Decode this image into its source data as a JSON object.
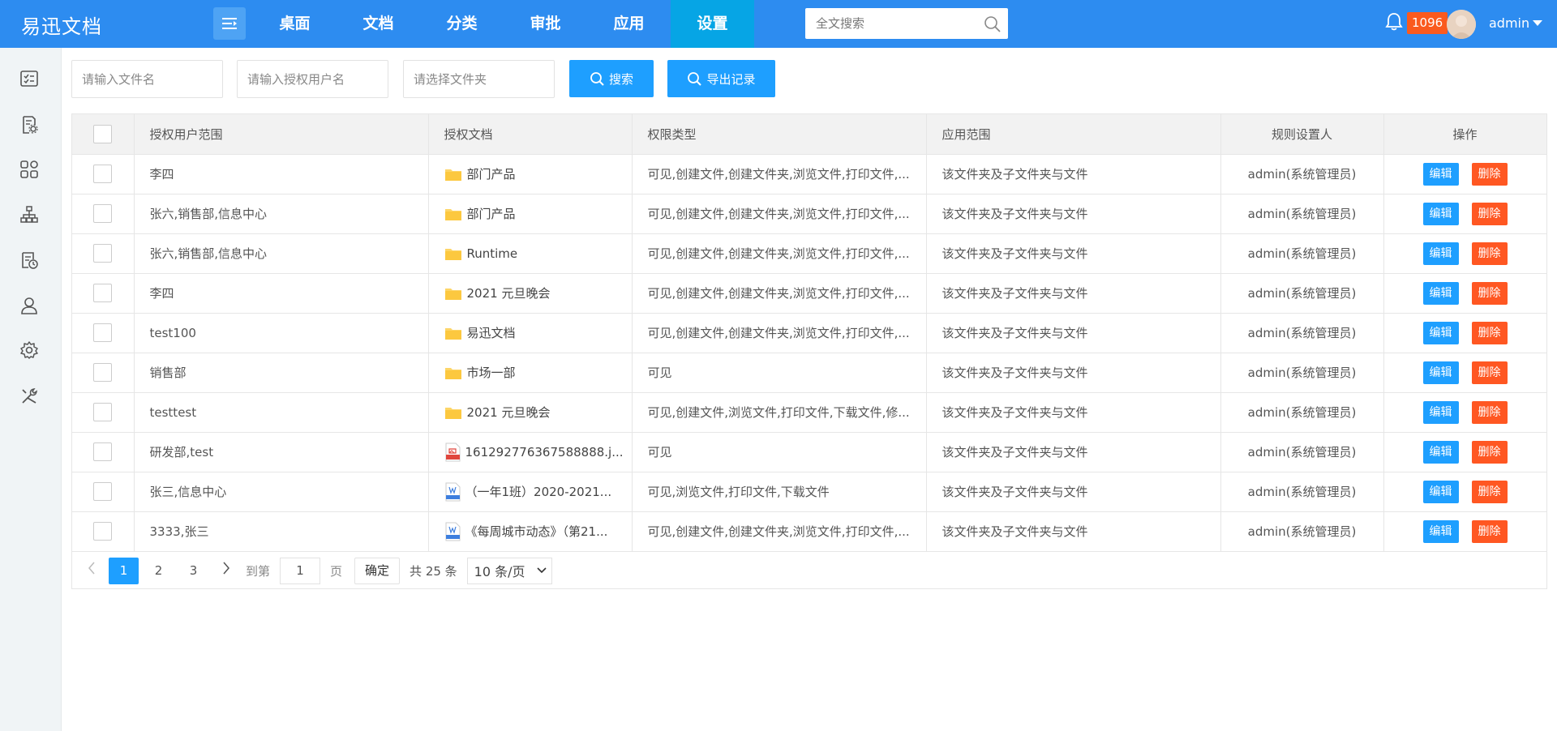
{
  "header": {
    "logo": "易迅文档",
    "nav": [
      "桌面",
      "文档",
      "分类",
      "审批",
      "应用",
      "设置"
    ],
    "active_nav": 5,
    "search_placeholder": "全文搜索",
    "notif_count": "1096",
    "user": "admin"
  },
  "sidebar": {
    "icons": [
      "list-check-icon",
      "document-settings-icon",
      "apps-grid-icon",
      "org-chart-icon",
      "schedule-doc-icon",
      "user-icon",
      "gear-icon",
      "tools-icon"
    ]
  },
  "filters": {
    "file_name_placeholder": "请输入文件名",
    "user_placeholder": "请输入授权用户名",
    "folder_placeholder": "请选择文件夹",
    "search_label": "搜索",
    "export_label": "导出记录"
  },
  "table": {
    "columns": [
      "授权用户范围",
      "授权文档",
      "权限类型",
      "应用范围",
      "规则设置人",
      "操作"
    ],
    "edit_label": "编辑",
    "delete_label": "删除",
    "rows": [
      {
        "users": "李四",
        "doc": "部门产品",
        "doc_type": "folder",
        "perm": "可见,创建文件,创建文件夹,浏览文件,打印文件,...",
        "scope": "该文件夹及子文件夹与文件",
        "setter": "admin(系统管理员)"
      },
      {
        "users": "张六,销售部,信息中心",
        "doc": "部门产品",
        "doc_type": "folder",
        "perm": "可见,创建文件,创建文件夹,浏览文件,打印文件,...",
        "scope": "该文件夹及子文件夹与文件",
        "setter": "admin(系统管理员)"
      },
      {
        "users": "张六,销售部,信息中心",
        "doc": "Runtime",
        "doc_type": "folder",
        "perm": "可见,创建文件,创建文件夹,浏览文件,打印文件,...",
        "scope": "该文件夹及子文件夹与文件",
        "setter": "admin(系统管理员)"
      },
      {
        "users": "李四",
        "doc": "2021 元旦晚会",
        "doc_type": "folder",
        "perm": "可见,创建文件,创建文件夹,浏览文件,打印文件,...",
        "scope": "该文件夹及子文件夹与文件",
        "setter": "admin(系统管理员)"
      },
      {
        "users": "test100",
        "doc": "易迅文档",
        "doc_type": "folder",
        "perm": "可见,创建文件,创建文件夹,浏览文件,打印文件,...",
        "scope": "该文件夹及子文件夹与文件",
        "setter": "admin(系统管理员)"
      },
      {
        "users": "销售部",
        "doc": "市场一部",
        "doc_type": "folder",
        "perm": "可见",
        "scope": "该文件夹及子文件夹与文件",
        "setter": "admin(系统管理员)"
      },
      {
        "users": "testtest",
        "doc": "2021 元旦晚会",
        "doc_type": "folder",
        "perm": "可见,创建文件,浏览文件,打印文件,下载文件,修...",
        "scope": "该文件夹及子文件夹与文件",
        "setter": "admin(系统管理员)"
      },
      {
        "users": "研发部,test",
        "doc": "161292776367588888.j...",
        "doc_type": "jpg",
        "perm": "可见",
        "scope": "该文件夹及子文件夹与文件",
        "setter": "admin(系统管理员)"
      },
      {
        "users": "张三,信息中心",
        "doc": "（一年1班）2020-2021...",
        "doc_type": "doc",
        "perm": "可见,浏览文件,打印文件,下载文件",
        "scope": "该文件夹及子文件夹与文件",
        "setter": "admin(系统管理员)"
      },
      {
        "users": "3333,张三",
        "doc": "《每周城市动态》（第21...",
        "doc_type": "doc",
        "perm": "可见,创建文件,创建文件夹,浏览文件,打印文件,...",
        "scope": "该文件夹及子文件夹与文件",
        "setter": "admin(系统管理员)"
      }
    ]
  },
  "pagination": {
    "pages": [
      "1",
      "2",
      "3"
    ],
    "current": "1",
    "goto_label": "到第",
    "goto_value": "1",
    "page_unit": "页",
    "confirm_label": "确定",
    "total_label": "共 25 条",
    "page_size": "10 条/页"
  }
}
